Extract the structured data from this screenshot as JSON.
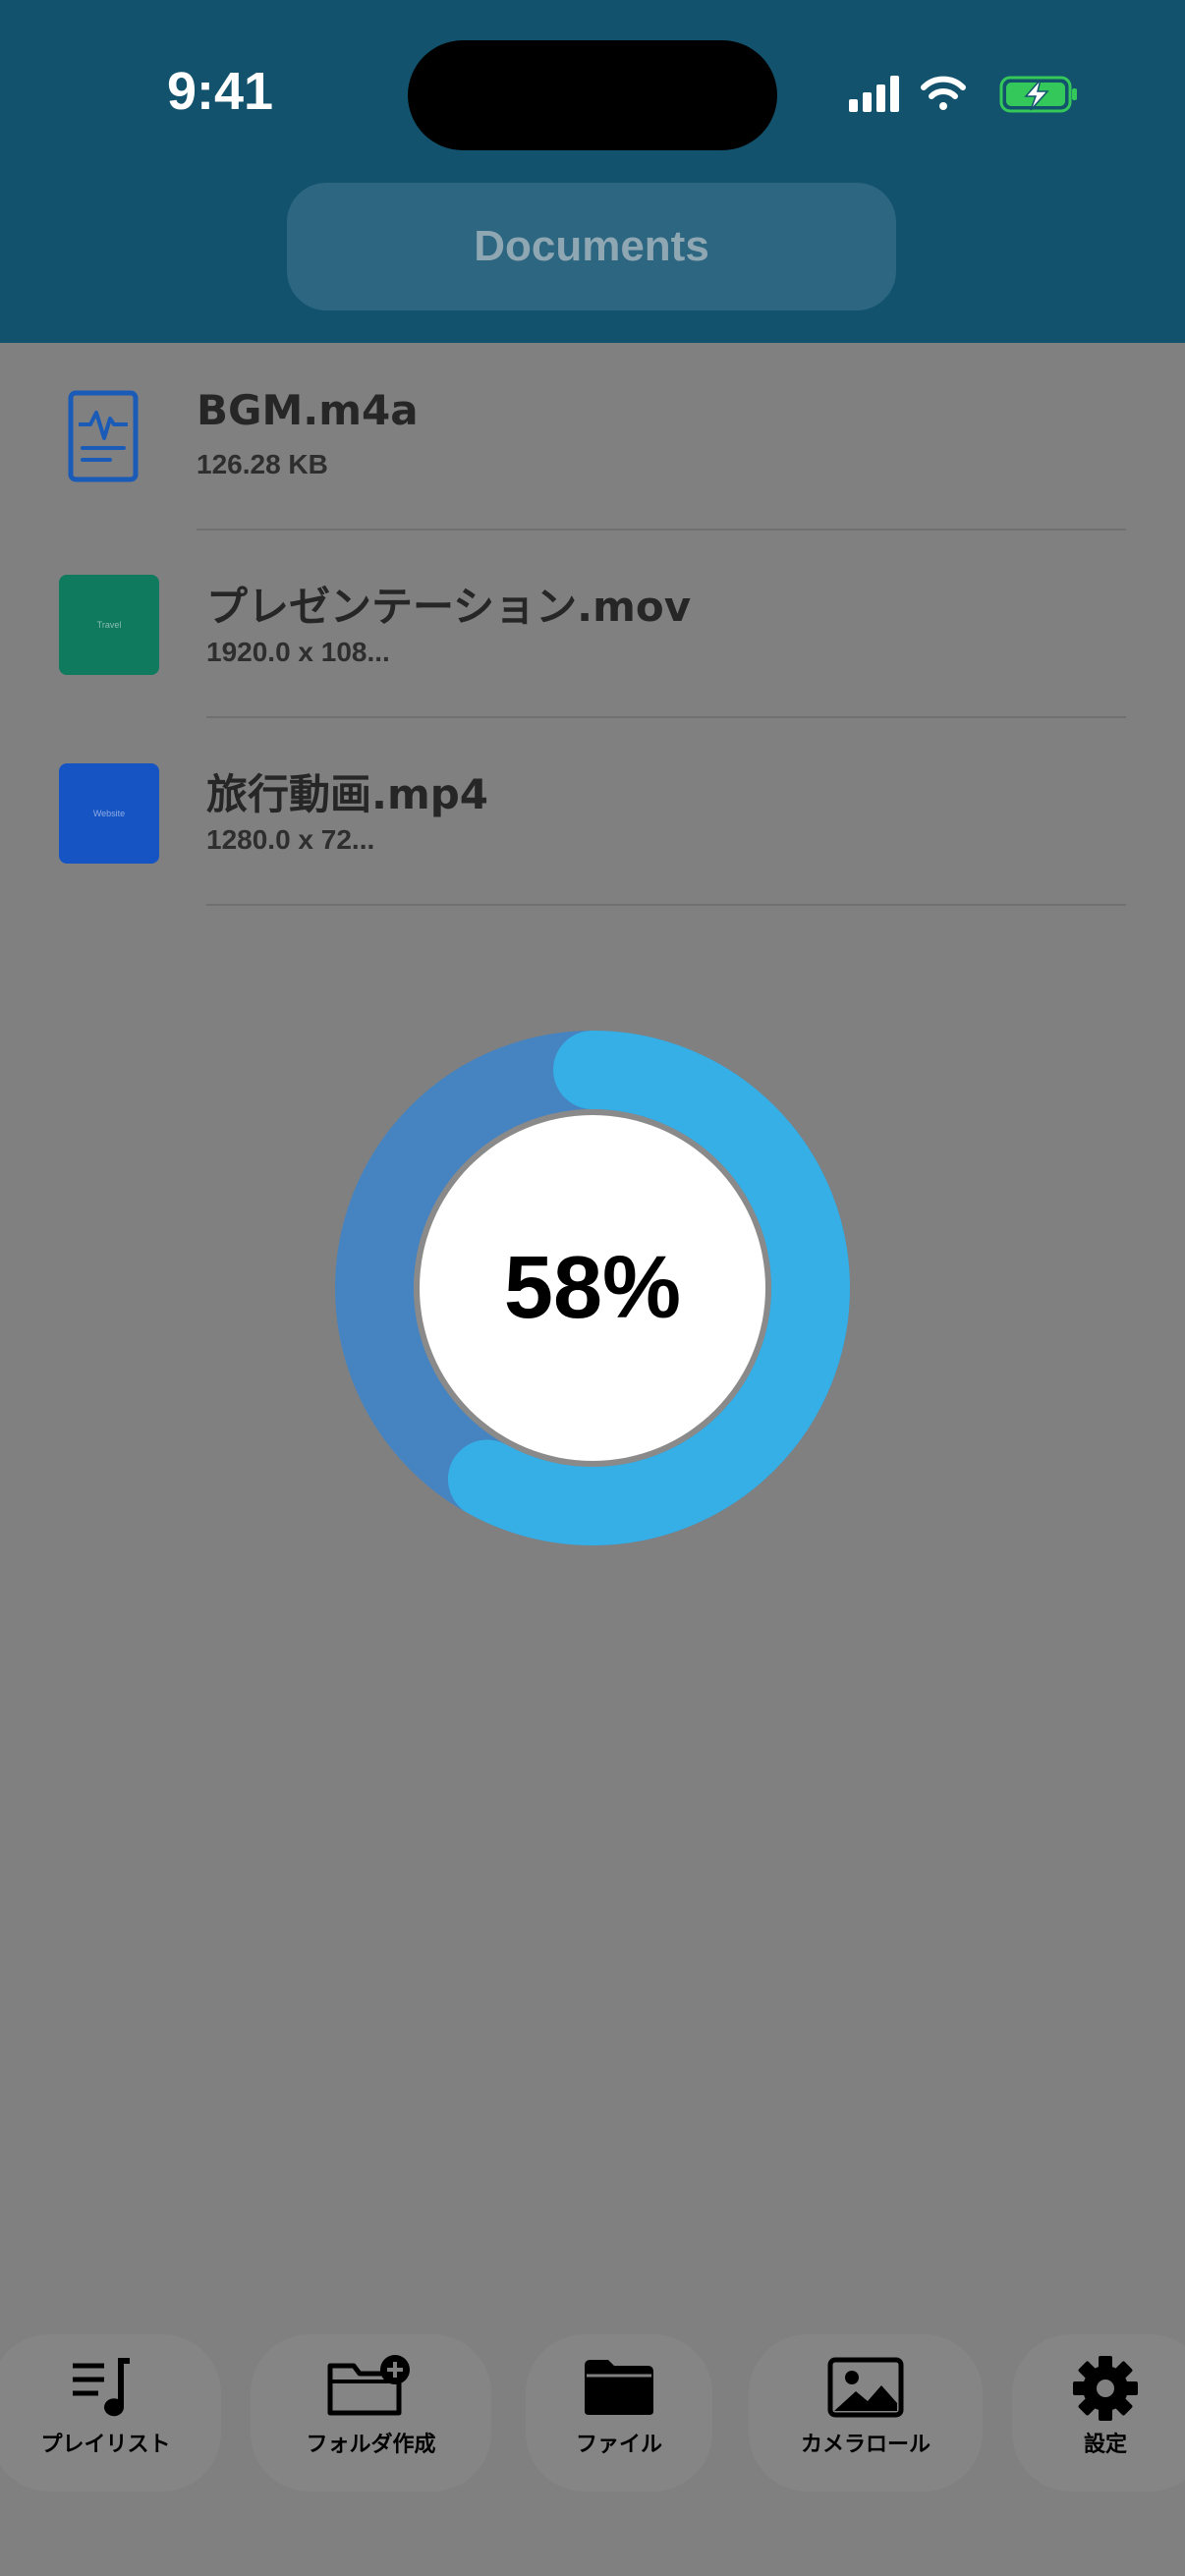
{
  "status_bar": {
    "time": "9:41"
  },
  "header": {
    "title": "Documents"
  },
  "files": [
    {
      "name": "BGM.m4a",
      "detail": "126.28 KB",
      "icon": "audio-document-icon"
    },
    {
      "name": "プレゼンテーション.mov",
      "detail": "1920.0 x 108...",
      "thumb_text": "Travel",
      "thumb_color": "#0f7a5e"
    },
    {
      "name": "旅行動画.mp4",
      "detail": "1280.0 x 72...",
      "thumb_text": "Website",
      "thumb_color": "#1654c4"
    }
  ],
  "progress": {
    "label": "58%",
    "value": 0.58
  },
  "tabs": [
    {
      "label": "プレイリスト",
      "icon": "playlist-music-icon"
    },
    {
      "label": "フォルダ作成",
      "icon": "folder-add-icon"
    },
    {
      "label": "ファイル",
      "icon": "folder-icon"
    },
    {
      "label": "カメラロール",
      "icon": "photo-icon"
    },
    {
      "label": "設定",
      "icon": "gear-icon"
    }
  ],
  "colors": {
    "header": "#12526d",
    "overlay": "#808080",
    "progress_track": "#4684c1",
    "progress_fill": "#35afe6",
    "battery": "#34c759"
  }
}
